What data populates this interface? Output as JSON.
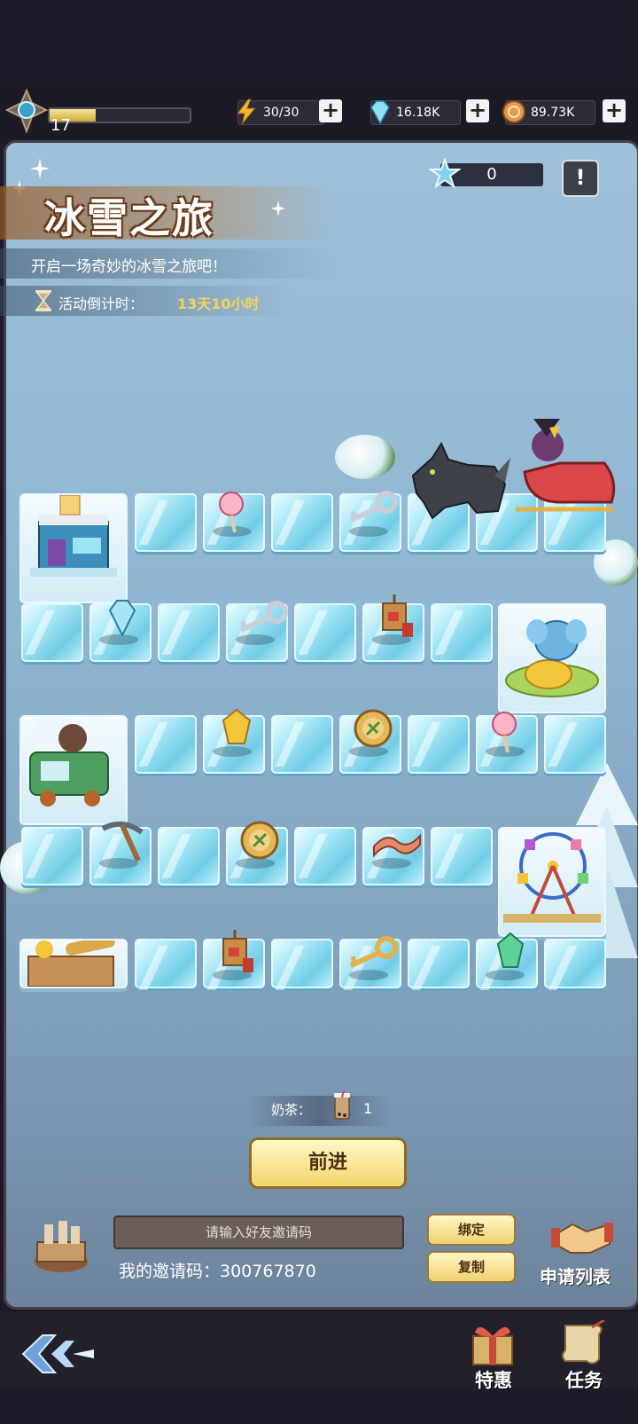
{
  "player": {
    "level": "17",
    "xp_fraction": 0.33
  },
  "resources": [
    {
      "name": "energy",
      "icon": "lightning-icon",
      "value": "30/30"
    },
    {
      "name": "diamond",
      "icon": "diamond-icon",
      "value": "16.18K"
    },
    {
      "name": "coin",
      "icon": "coin-icon",
      "value": "89.73K"
    }
  ],
  "event": {
    "title": "冰雪之旅",
    "subtitle": "开启一场奇妙的冰雪之旅吧！",
    "countdown_label": "活动倒计时：",
    "countdown_value": "13天10小时",
    "stars": "0"
  },
  "board": {
    "items": [
      "lollipop-icon",
      "key-icon",
      "diamond-icon",
      "key-icon",
      "firecracker-icon",
      "gold-crystal-icon",
      "coin-icon",
      "lollipop-icon",
      "pickaxe-icon",
      "coin-icon",
      "bacon-icon",
      "firecracker-icon",
      "key-icon",
      "green-crystal-icon"
    ]
  },
  "milk_tea": {
    "label": "奶茶：",
    "count": "1"
  },
  "go_button": "前进",
  "invite": {
    "placeholder": "请输入好友邀请码",
    "my_code": "我的邀请码：300767870",
    "bind_label": "绑定",
    "copy_label": "复制",
    "apply_list_label": "申请列表"
  },
  "nav": {
    "offer_label": "特惠",
    "task_label": "任务"
  },
  "colors": {
    "accent_gold": "#f5d35a",
    "ice": "#a9e8f7",
    "frame": "#463f4c"
  }
}
